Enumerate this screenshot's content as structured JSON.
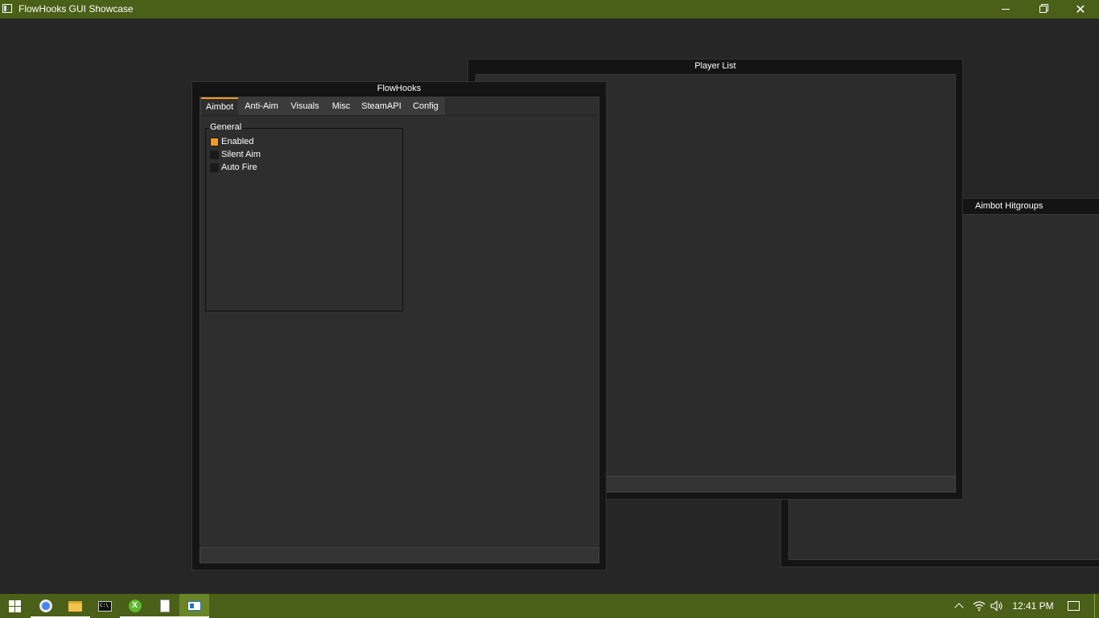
{
  "window": {
    "title": "FlowHooks GUI Showcase",
    "controls": {
      "minimize": "minimize",
      "maximize": "restore",
      "close": "✕"
    }
  },
  "player_list": {
    "title": "Player List"
  },
  "hitgroups": {
    "title": "Aimbot Hitgroups"
  },
  "flowhooks": {
    "title": "FlowHooks",
    "tabs": [
      {
        "label": "Aimbot",
        "active": true
      },
      {
        "label": "Anti-Aim",
        "active": false
      },
      {
        "label": "Visuals",
        "active": false
      },
      {
        "label": "Misc",
        "active": false
      },
      {
        "label": "SteamAPI",
        "active": false
      },
      {
        "label": "Config",
        "active": false
      }
    ],
    "general_group": {
      "title": "General",
      "checkboxes": [
        {
          "label": "Enabled",
          "checked": true
        },
        {
          "label": "Silent Aim",
          "checked": false
        },
        {
          "label": "Auto Fire",
          "checked": false
        }
      ]
    }
  },
  "taskbar": {
    "apps": [
      "windows-start-icon",
      "chrome-icon",
      "file-explorer-icon",
      "command-prompt-icon",
      "xbox-icon",
      "document-icon",
      "flowhooks-app-icon"
    ],
    "clock": "12:41 PM"
  },
  "colors": {
    "accent": "#f59b1c",
    "titlebar": "#4a5f17",
    "background": "#262626"
  }
}
